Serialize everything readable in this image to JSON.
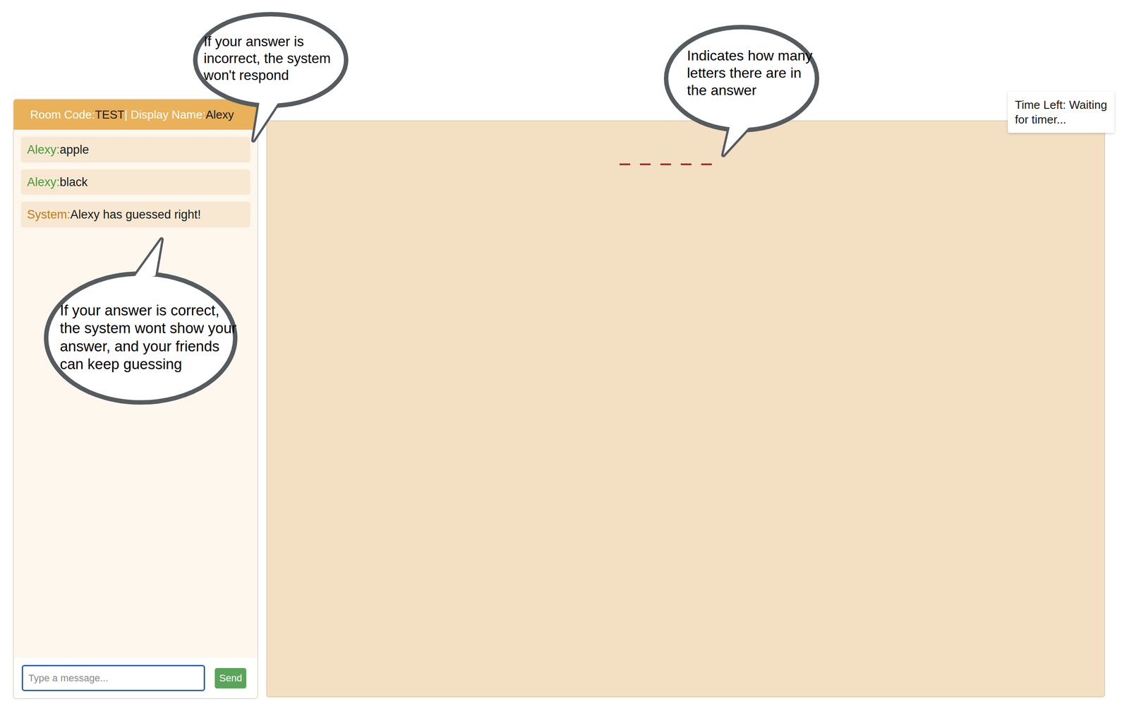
{
  "header": {
    "room_code_label": "Room Code:",
    "room_code": "TEST",
    "display_name_label": "| Display Name:",
    "display_name": "Alexy"
  },
  "messages": [
    {
      "sender": "Alexy:",
      "text": "apple",
      "color": "#4a9a3a"
    },
    {
      "sender": "Alexy:",
      "text": "black",
      "color": "#4a9a3a"
    },
    {
      "sender": "System:",
      "text": "Alexy has guessed right!",
      "color": "#c07a2a"
    }
  ],
  "input": {
    "placeholder": "Type a message...",
    "focused": true
  },
  "send_button": "Send",
  "word_hint": {
    "letter_count": 5
  },
  "timer": {
    "label": "Time Left:",
    "value": "Waiting for timer..."
  },
  "annotations": [
    {
      "kind": "incorrect",
      "text": "If your answer is incorrect, the system won't respond"
    },
    {
      "kind": "letters",
      "text": "Indicates how many letters there are in the answer"
    },
    {
      "kind": "correct",
      "text": "If your answer is correct, the system wont show your answer, and your friends can keep guessing"
    }
  ]
}
